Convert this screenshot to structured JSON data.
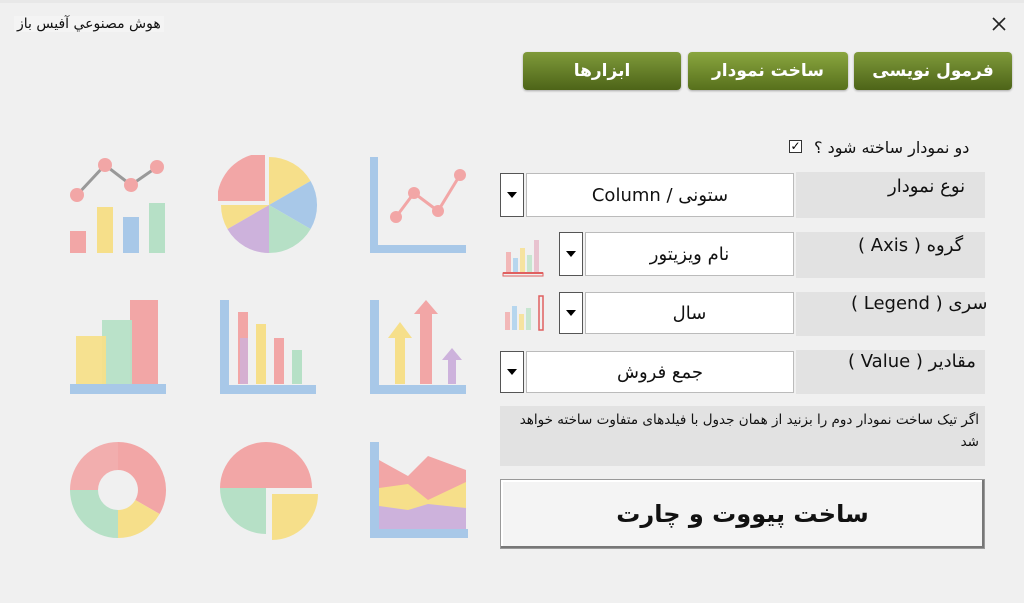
{
  "window": {
    "title": "هوش مصنوعي آفیس باز"
  },
  "tabs": [
    {
      "label": "فرمول نویسی"
    },
    {
      "label": "ساخت نمودار"
    },
    {
      "label": "ابزارها"
    }
  ],
  "form": {
    "two_charts_label": "دو نمودار ساخته شود ؟",
    "two_charts_checked": "✓",
    "chart_type_label": "نوع نمودار",
    "chart_type_value": "ستونی / Column",
    "group_label": "گروه ( Axis )",
    "group_value": "نام ویزیتور",
    "series_label": "سری ( Legend )",
    "series_value": "سال",
    "values_label": "مقادیر ( Value )",
    "values_value": "جمع فروش",
    "note": "اگر تیک ساخت نمودار دوم را بزنید از همان جدول با فیلدهای متفاوت ساخته خواهد شد",
    "build_button": "ساخت پیووت و چارت"
  },
  "icons": [
    "line-bar-combo-chart-icon",
    "pie-chart-icon",
    "line-chart-icon",
    "stacked-bar-chart-icon",
    "column-chart-icon",
    "arrow-bar-chart-icon",
    "donut-chart-icon",
    "exploded-pie-chart-icon",
    "area-chart-icon"
  ],
  "colors": {
    "tab_green": "#5e7a22",
    "pastel_red": "#f2a6a6",
    "pastel_yellow": "#f6df8a",
    "pastel_blue": "#a8c8e8",
    "pastel_green": "#b6e0c6",
    "pastel_purple": "#cdb2dc"
  }
}
